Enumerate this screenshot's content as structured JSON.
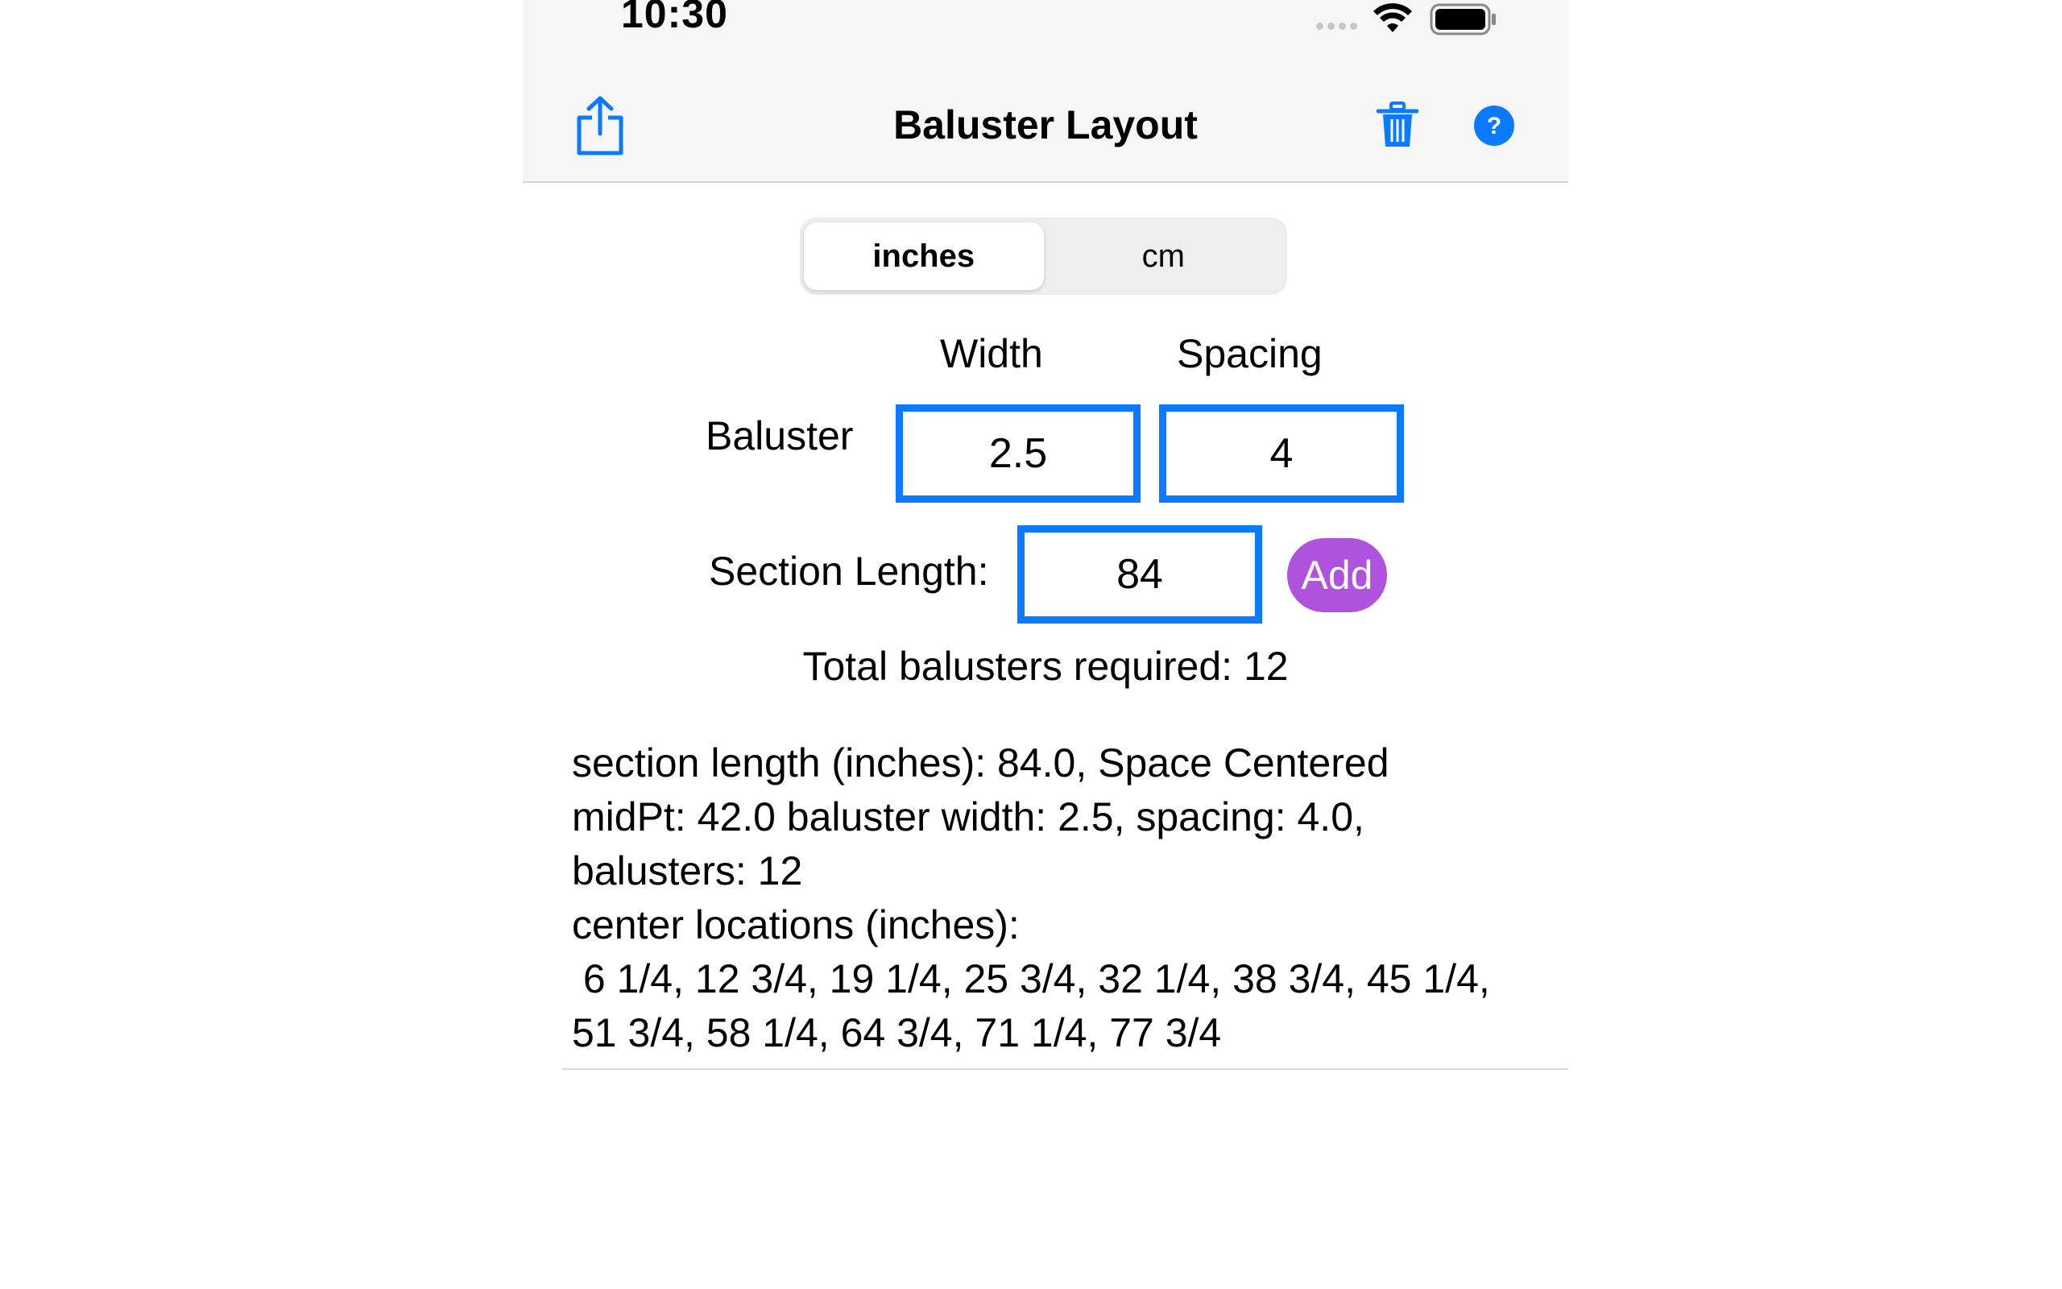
{
  "status_bar": {
    "time": "10:30",
    "icons": [
      "cellular-signal-icon",
      "wifi-icon",
      "battery-icon"
    ]
  },
  "nav": {
    "title": "Baluster Layout",
    "icons": [
      "share-icon",
      "trash-icon",
      "help-icon"
    ],
    "accent_color": "#0a7bff"
  },
  "units": {
    "options": [
      "inches",
      "cm"
    ],
    "selected": "inches"
  },
  "inputs": {
    "width_label": "Width",
    "spacing_label": "Spacing",
    "baluster_label": "Baluster",
    "width_value": "2.5",
    "spacing_value": "4",
    "section_length_label": "Section Length:",
    "section_length_value": "84",
    "add_label": "Add",
    "add_color": "#af52de"
  },
  "total": {
    "text": "Total balusters required: 12"
  },
  "results": {
    "lines": [
      "section length (inches): 84.0, Space Centered",
      "midPt: 42.0 baluster width: 2.5, spacing: 4.0,",
      "balusters: 12",
      "center locations (inches):",
      " 6 1/4, 12 3/4, 19 1/4, 25 3/4, 32 1/4, 38 3/4, 45 1/4,",
      "51 3/4, 58 1/4, 64 3/4, 71 1/4, 77 3/4"
    ]
  }
}
